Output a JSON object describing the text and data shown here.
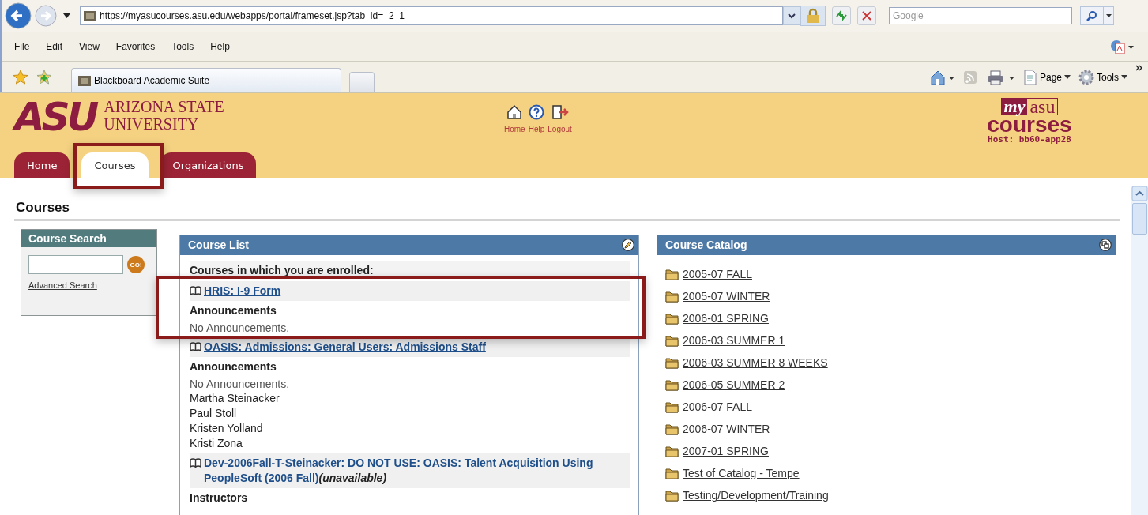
{
  "browser": {
    "address": "https://myasucourses.asu.edu/webapps/portal/frameset.jsp?tab_id=_2_1",
    "search_placeholder": "Google",
    "menu": [
      "File",
      "Edit",
      "View",
      "Favorites",
      "Tools",
      "Help"
    ],
    "tabs": [
      {
        "label": "Blackboard Academic Suite",
        "selected": true
      }
    ],
    "commands": [
      "Page",
      "Tools"
    ]
  },
  "header": {
    "logo_mark": "ASU",
    "logo_line1": "ARIZONA STATE",
    "logo_line2": "UNIVERSITY",
    "links": [
      {
        "kind": "home",
        "label": "Home"
      },
      {
        "kind": "help",
        "label": "Help"
      },
      {
        "kind": "logout",
        "label": "Logout"
      }
    ],
    "brand_my": "my",
    "brand_asu": "asu",
    "brand_courses": "courses",
    "host": "Host: bb60-app28",
    "tabs": [
      {
        "label": "Home",
        "selected": false
      },
      {
        "label": "Courses",
        "selected": true
      },
      {
        "label": "Organizations",
        "selected": false
      }
    ]
  },
  "page_title": "Courses",
  "course_search": {
    "title": "Course Search",
    "go": "GO!",
    "link": "Advanced Search"
  },
  "course_list": {
    "title": "Course List",
    "intro": "Courses in which you are enrolled:",
    "items": [
      {
        "kind": "course",
        "text": "HRIS: I-9 Form"
      },
      {
        "kind": "heading",
        "text": "Announcements"
      },
      {
        "kind": "note",
        "text": "No Announcements."
      },
      {
        "kind": "course",
        "text": "OASIS: Admissions: General Users: Admissions Staff"
      },
      {
        "kind": "heading",
        "text": "Announcements"
      },
      {
        "kind": "note",
        "text": "No Announcements."
      },
      {
        "kind": "name",
        "text": "Martha Steinacker"
      },
      {
        "kind": "name",
        "text": "Paul Stoll"
      },
      {
        "kind": "name",
        "text": "Kristen Yolland"
      },
      {
        "kind": "name",
        "text": "Kristi Zona"
      },
      {
        "kind": "course",
        "text": "Dev-2006Fall-T-Steinacker: DO NOT USE: OASIS: Talent Acquisition Using PeopleSoft (2006 Fall)",
        "status": "(unavailable)"
      },
      {
        "kind": "heading",
        "text": "Instructors"
      }
    ]
  },
  "course_catalog": {
    "title": "Course Catalog",
    "items": [
      "2005-07 FALL",
      "2005-07 WINTER",
      "2006-01 SPRING",
      "2006-03 SUMMER 1",
      "2006-03 SUMMER 8 WEEKS",
      "2006-05 SUMMER 2",
      "2006-07 FALL",
      "2006-07 WINTER",
      "2007-01 SPRING",
      "Test of Catalog - Tempe",
      "Testing/Development/Training"
    ]
  }
}
